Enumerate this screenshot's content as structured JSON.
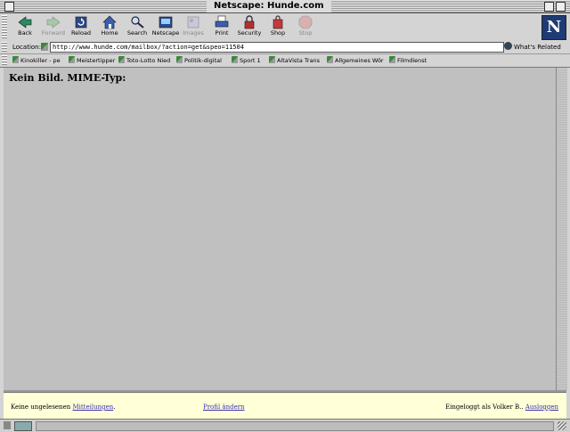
{
  "window": {
    "title": "Netscape: Hunde.com"
  },
  "toolbar": {
    "back": "Back",
    "forward": "Forward",
    "reload": "Reload",
    "home": "Home",
    "search": "Search",
    "netscape": "Netscape",
    "images": "Images",
    "print": "Print",
    "security": "Security",
    "shop": "Shop",
    "stop": "Stop",
    "logo": "N"
  },
  "location": {
    "label": "Location:",
    "url": "http://www.hunde.com/mailbox/?action=get&speo=11504",
    "related": "What's Related"
  },
  "personal": [
    "Kinokiller - pe",
    "Meistertipper",
    "Toto-Lotto Nied",
    "Politik-digital",
    "Sport 1",
    "AltaVista Trans",
    "Allgemeines Wör",
    "Filmdienst"
  ],
  "content": {
    "heading": "Kein Bild. MIME-Typ:"
  },
  "footer": {
    "unread_prefix": "Keine ungelesenen",
    "unread_link": "Mitteilungen",
    "profile_link": "Profil ändern",
    "logged_prefix": "Eingeloggt als Volker B..",
    "logout_link": "Ausloggen"
  },
  "colors": {
    "content_bg": "#c0c0c0",
    "footer_bg": "#ffffd8",
    "link": "#3b2fb0"
  }
}
